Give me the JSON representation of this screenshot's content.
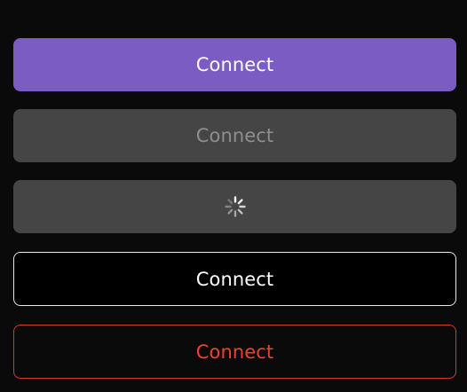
{
  "buttons": {
    "primary": {
      "label": "Connect",
      "color": "#7b5cc2"
    },
    "disabled": {
      "label": "Connect",
      "color": "#454545"
    },
    "loading": {
      "state": "loading",
      "icon": "spinner-icon"
    },
    "outline": {
      "label": "Connect",
      "border_color": "#e9e9e9"
    },
    "danger": {
      "label": "Connect",
      "color": "#e8452c"
    }
  }
}
